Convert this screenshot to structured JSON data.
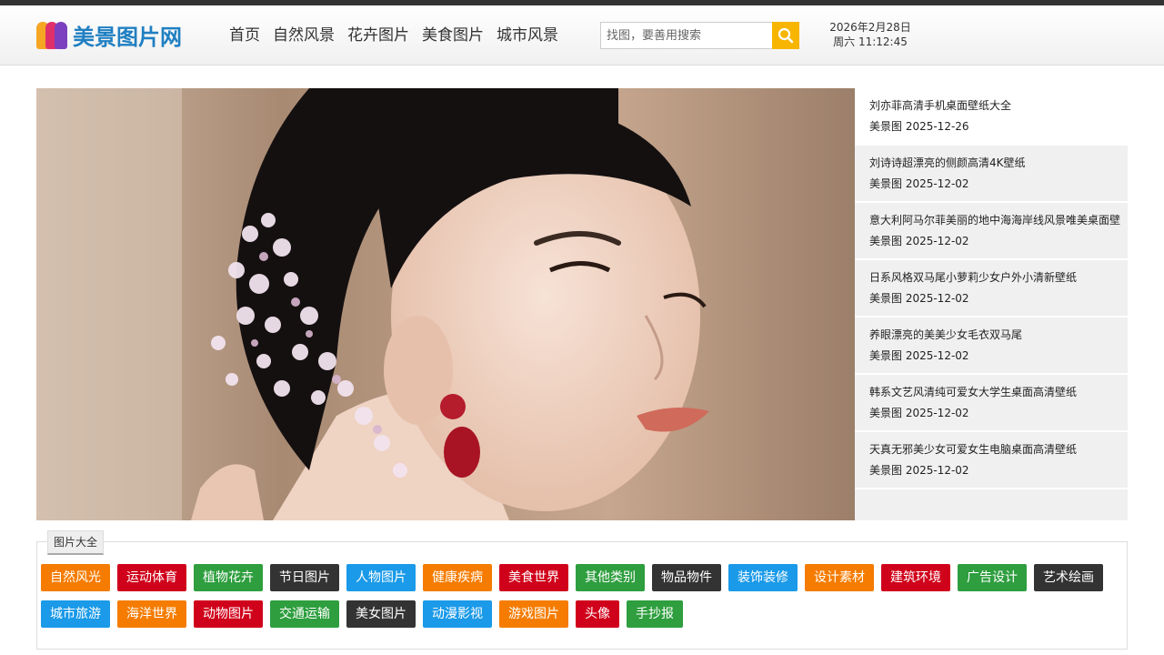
{
  "site": {
    "logo_text": "美景图片网"
  },
  "nav": {
    "items": [
      "首页",
      "自然风景",
      "花卉图片",
      "美食图片",
      "城市风景"
    ]
  },
  "search": {
    "placeholder": "找图，要善用搜索"
  },
  "datetime": {
    "date": "2026年2月28日",
    "time": "周六 11:12:45"
  },
  "hero": {
    "description": "portrait photo"
  },
  "sidebar": {
    "items": [
      {
        "title": "刘亦菲高清手机桌面壁纸大全",
        "meta": "美景图 2025-12-26"
      },
      {
        "title": "刘诗诗超漂亮的侧颜高清4K壁纸",
        "meta": "美景图 2025-12-02"
      },
      {
        "title": "意大利阿马尔菲美丽的地中海海岸线风景唯美桌面壁",
        "meta": "美景图 2025-12-02"
      },
      {
        "title": "日系风格双马尾小萝莉少女户外小清新壁纸",
        "meta": "美景图 2025-12-02"
      },
      {
        "title": "养眼漂亮的美美少女毛衣双马尾",
        "meta": "美景图 2025-12-02"
      },
      {
        "title": "韩系文艺风清纯可爱女大学生桌面高清壁纸",
        "meta": "美景图 2025-12-02"
      },
      {
        "title": "天真无邪美少女可爱女生电脑桌面高清壁纸",
        "meta": "美景图 2025-12-02"
      }
    ]
  },
  "categories": {
    "title": "图片大全",
    "tags": [
      {
        "label": "自然风光",
        "color": "#f57c00"
      },
      {
        "label": "运动体育",
        "color": "#d0021b"
      },
      {
        "label": "植物花卉",
        "color": "#2e9e3e"
      },
      {
        "label": "节日图片",
        "color": "#333333"
      },
      {
        "label": "人物图片",
        "color": "#1a9ae8"
      },
      {
        "label": "健康疾病",
        "color": "#f57c00"
      },
      {
        "label": "美食世界",
        "color": "#d0021b"
      },
      {
        "label": "其他类别",
        "color": "#2e9e3e"
      },
      {
        "label": "物品物件",
        "color": "#333333"
      },
      {
        "label": "装饰装修",
        "color": "#1a9ae8"
      },
      {
        "label": "设计素材",
        "color": "#f57c00"
      },
      {
        "label": "建筑环境",
        "color": "#d0021b"
      },
      {
        "label": "广告设计",
        "color": "#2e9e3e"
      },
      {
        "label": "艺术绘画",
        "color": "#333333"
      },
      {
        "label": "城市旅游",
        "color": "#1a9ae8"
      },
      {
        "label": "海洋世界",
        "color": "#f57c00"
      },
      {
        "label": "动物图片",
        "color": "#d0021b"
      },
      {
        "label": "交通运输",
        "color": "#2e9e3e"
      },
      {
        "label": "美女图片",
        "color": "#333333"
      },
      {
        "label": "动漫影视",
        "color": "#1a9ae8"
      },
      {
        "label": "游戏图片",
        "color": "#f57c00"
      },
      {
        "label": "头像",
        "color": "#d0021b"
      },
      {
        "label": "手抄报",
        "color": "#2e9e3e"
      }
    ]
  },
  "icons": {
    "search": "search-icon"
  }
}
